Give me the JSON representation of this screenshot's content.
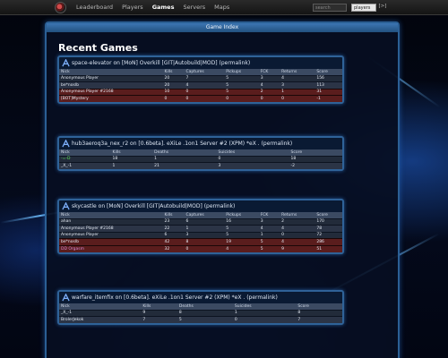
{
  "colors": {
    "accent": "#2f6298",
    "team_red": "#5a1d1d",
    "header": "#3c76b3"
  },
  "topnav": {
    "logo_icon": "xonotic-logo-icon",
    "items": [
      {
        "label": "Leaderboard",
        "active": false
      },
      {
        "label": "Players",
        "active": false
      },
      {
        "label": "Games",
        "active": true
      },
      {
        "label": "Servers",
        "active": false
      },
      {
        "label": "Maps",
        "active": false
      }
    ],
    "search_value": "search",
    "select_value": "players",
    "go_label": "[>]"
  },
  "panel": {
    "header": "Game Index",
    "title": "Recent Games"
  },
  "games": [
    {
      "title": "space-elevator on [MoN] Overkill [GIT|Autobuild|MOD] (permalink)",
      "columns": [
        "Nick",
        "Kills",
        "Captures",
        "Pickups",
        "FCK",
        "Returns",
        "Score"
      ],
      "rows": [
        {
          "cells": [
            "Anonymous Player",
            "20",
            "7",
            "5",
            "3",
            "4",
            "156"
          ],
          "team": "blue"
        },
        {
          "cells": [
            "be*noslb",
            "20",
            "4",
            "5",
            "4",
            "3",
            "113"
          ],
          "team": "blue"
        },
        {
          "cells": [
            "Anonymous Player #2168",
            "10",
            "0",
            "5",
            "2",
            "1",
            "31"
          ],
          "team": "red"
        },
        {
          "cells": [
            "[BOT]Mystery",
            "0",
            "0",
            "0",
            "0",
            "0",
            "-1"
          ],
          "team": "red"
        }
      ]
    },
    {
      "title": "hub3aeroq3a_nex_r2 on [0.6beta]. eXiLe .1on1 Server #2 (XPM) *eX . (permalink)",
      "columns": [
        "Nick",
        "Kills",
        "Deaths",
        "Suicides",
        "Score"
      ],
      "rows": [
        {
          "cells": [
            "-=-D",
            "18",
            "1",
            "0",
            "18"
          ],
          "team": "none",
          "nick_color": "green"
        },
        {
          "cells": [
            "_X_-1",
            "1",
            "21",
            "3",
            "-2"
          ],
          "team": "none",
          "nick_color": "white"
        }
      ]
    },
    {
      "title": "skycastle on [MoN] Overkill [GIT|Autobuild|MOD] (permalink)",
      "columns": [
        "Nick",
        "Kills",
        "Captures",
        "Pickups",
        "FCK",
        "Returns",
        "Score"
      ],
      "rows": [
        {
          "cells": [
            "ahan",
            "23",
            "6",
            "16",
            "3",
            "2",
            "170"
          ],
          "team": "blue"
        },
        {
          "cells": [
            "Anonymous Player #2168",
            "22",
            "1",
            "5",
            "4",
            "4",
            "78"
          ],
          "team": "blue"
        },
        {
          "cells": [
            "Anonymous Player",
            "6",
            "3",
            "5",
            "1",
            "0",
            "72"
          ],
          "team": "blue"
        },
        {
          "cells": [
            "be*noslb",
            "42",
            "8",
            "19",
            "5",
            "4",
            "286"
          ],
          "team": "red"
        },
        {
          "cells": [
            "DD Orgasm",
            "32",
            "0",
            "4",
            "5",
            "9",
            "51"
          ],
          "team": "red"
        }
      ]
    },
    {
      "title": "warfare_itemfix on [0.6beta]. eXiLe .1on1 Server #2 (XPM) *eX . (permalink)",
      "columns": [
        "Nick",
        "Kills",
        "Deaths",
        "Suicides",
        "Score"
      ],
      "rows": [
        {
          "cells": [
            "_X_-1",
            "9",
            "8",
            "1",
            "8"
          ],
          "team": "none",
          "nick_color": "white"
        },
        {
          "cells": [
            "BrolerJekok",
            "7",
            "5",
            "0",
            "7"
          ],
          "team": "none",
          "nick_color": "white"
        }
      ]
    }
  ]
}
